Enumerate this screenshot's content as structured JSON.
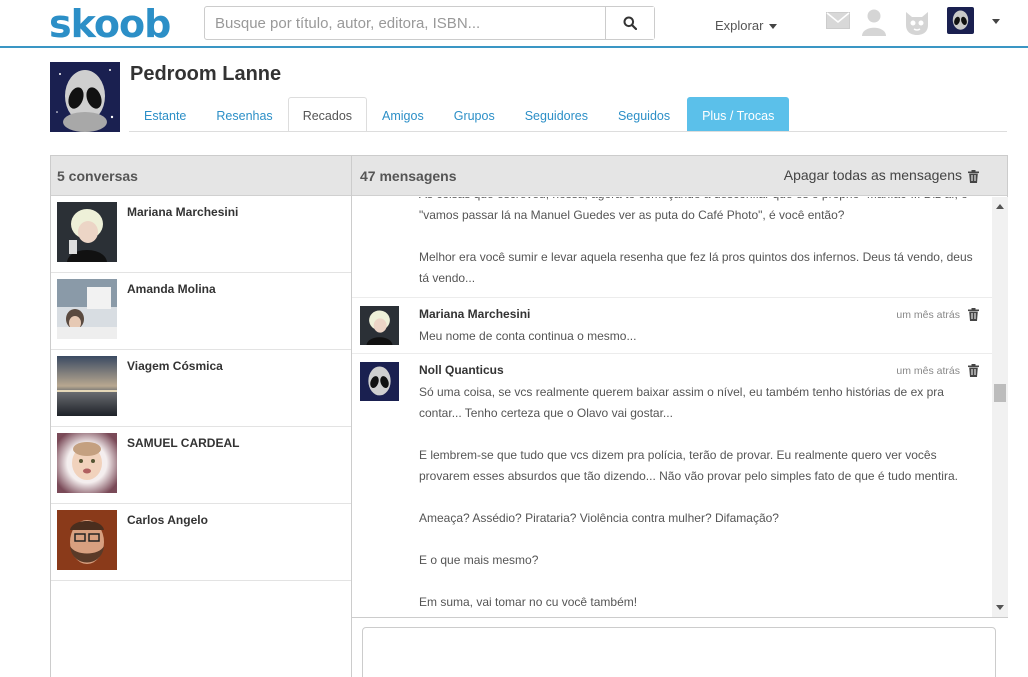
{
  "topbar": {
    "logo": "skoob",
    "search_placeholder": "Busque por título, autor, editora, ISBN...",
    "explore_label": "Explorar",
    "icons": [
      "search-icon",
      "mail-icon",
      "user-icon",
      "cat-icon",
      "avatar"
    ],
    "accent_color": "#2c8fc7"
  },
  "profile": {
    "name": "Pedroom Lanne",
    "tabs": [
      "Estante",
      "Resenhas",
      "Recados",
      "Amigos",
      "Grupos",
      "Seguidores",
      "Seguidos",
      "Plus / Trocas"
    ],
    "active_tab": "Recados"
  },
  "conversations": {
    "header": "5 conversas",
    "items": [
      {
        "name": "Mariana Marchesini"
      },
      {
        "name": "Amanda Molina"
      },
      {
        "name": "Viagem Cósmica"
      },
      {
        "name": "SAMUEL CARDEAL"
      },
      {
        "name": "Carlos Angelo"
      }
    ]
  },
  "messages": {
    "header": "47 mensagens",
    "delete_all_label": "Apagar todas as mensagens",
    "partial_message": {
      "lines": [
        "As coisas que escreveu, nossa, agora to começando a desconfiar que és o próprio \"Maníac\"... Diz aí, o",
        "\"vamos passar lá na Manuel Guedes ver as puta do Café Photo\", é você então?"
      ],
      "paragraph": "Melhor era você sumir e levar aquela resenha que fez lá pros quintos dos infernos. Deus tá vendo, deus tá vendo..."
    },
    "items": [
      {
        "author": "Mariana Marchesini",
        "time": "um mês atrás",
        "paragraphs": [
          "Meu nome de conta continua o mesmo..."
        ]
      },
      {
        "author": "Noll Quanticus",
        "time": "um mês atrás",
        "paragraphs": [
          "Só uma coisa, se vcs realmente querem baixar assim o nível, eu também tenho histórias de ex pra contar... Tenho certeza que o Olavo vai gostar...",
          "E lembrem-se que tudo que vcs dizem pra polícia, terão de provar. Eu realmente quero ver vocês provarem esses absurdos que tão dizendo... Não vão provar pelo simples fato de que é tudo mentira.",
          "Ameaça? Assédio? Pirataria? Violência contra mulher? Difamação?",
          "E o que mais mesmo?",
          "Em suma, vai tomar no cu você também!"
        ]
      }
    ]
  }
}
